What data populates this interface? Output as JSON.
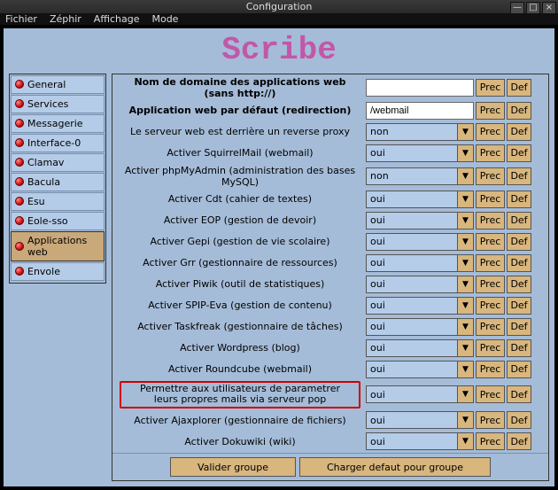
{
  "window": {
    "title": "Configuration",
    "minimize": "—",
    "maximize": "□",
    "close": "×"
  },
  "menu": {
    "file": "Fichier",
    "zephir": "Zéphir",
    "affichage": "Affichage",
    "mode": "Mode"
  },
  "app_title": "Scribe",
  "sidebar": {
    "items": [
      {
        "label": "General"
      },
      {
        "label": "Services"
      },
      {
        "label": "Messagerie"
      },
      {
        "label": "Interface-0"
      },
      {
        "label": "Clamav"
      },
      {
        "label": "Bacula"
      },
      {
        "label": "Esu"
      },
      {
        "label": "Eole-sso"
      },
      {
        "label": "Applications web"
      },
      {
        "label": "Envole"
      }
    ]
  },
  "selected_index": 8,
  "buttons": {
    "prec": "Prec",
    "def": "Def"
  },
  "rows": [
    {
      "label": "Nom de domaine des applications web (sans http://)",
      "value": "",
      "type": "text",
      "bold": true
    },
    {
      "label": "Application web par défaut (redirection)",
      "value": "/webmail",
      "type": "text",
      "bold": true
    },
    {
      "label": "Le serveur web est derrière un reverse proxy",
      "value": "non",
      "type": "select"
    },
    {
      "label": "Activer SquirrelMail (webmail)",
      "value": "oui",
      "type": "select"
    },
    {
      "label": "Activer phpMyAdmin (administration des bases MySQL)",
      "value": "non",
      "type": "select"
    },
    {
      "label": "Activer Cdt (cahier de textes)",
      "value": "oui",
      "type": "select"
    },
    {
      "label": "Activer EOP (gestion de devoir)",
      "value": "oui",
      "type": "select"
    },
    {
      "label": "Activer Gepi (gestion de vie scolaire)",
      "value": "oui",
      "type": "select"
    },
    {
      "label": "Activer Grr (gestionnaire de ressources)",
      "value": "oui",
      "type": "select"
    },
    {
      "label": "Activer Piwik (outil de statistiques)",
      "value": "oui",
      "type": "select"
    },
    {
      "label": "Activer SPIP-Eva (gestion de contenu)",
      "value": "oui",
      "type": "select"
    },
    {
      "label": "Activer Taskfreak (gestionnaire de tâches)",
      "value": "oui",
      "type": "select"
    },
    {
      "label": "Activer Wordpress (blog)",
      "value": "oui",
      "type": "select"
    },
    {
      "label": "Activer Roundcube (webmail)",
      "value": "oui",
      "type": "select"
    },
    {
      "label": "Permettre aux utilisateurs de parametrer leurs propres mails via serveur pop",
      "value": "oui",
      "type": "select",
      "highlight": true
    },
    {
      "label": "Activer Ajaxplorer (gestionnaire de fichiers)",
      "value": "oui",
      "type": "select"
    },
    {
      "label": "Activer Dokuwiki (wiki)",
      "value": "oui",
      "type": "select"
    }
  ],
  "footer": {
    "validate": "Valider groupe",
    "load_default": "Charger defaut pour groupe"
  }
}
